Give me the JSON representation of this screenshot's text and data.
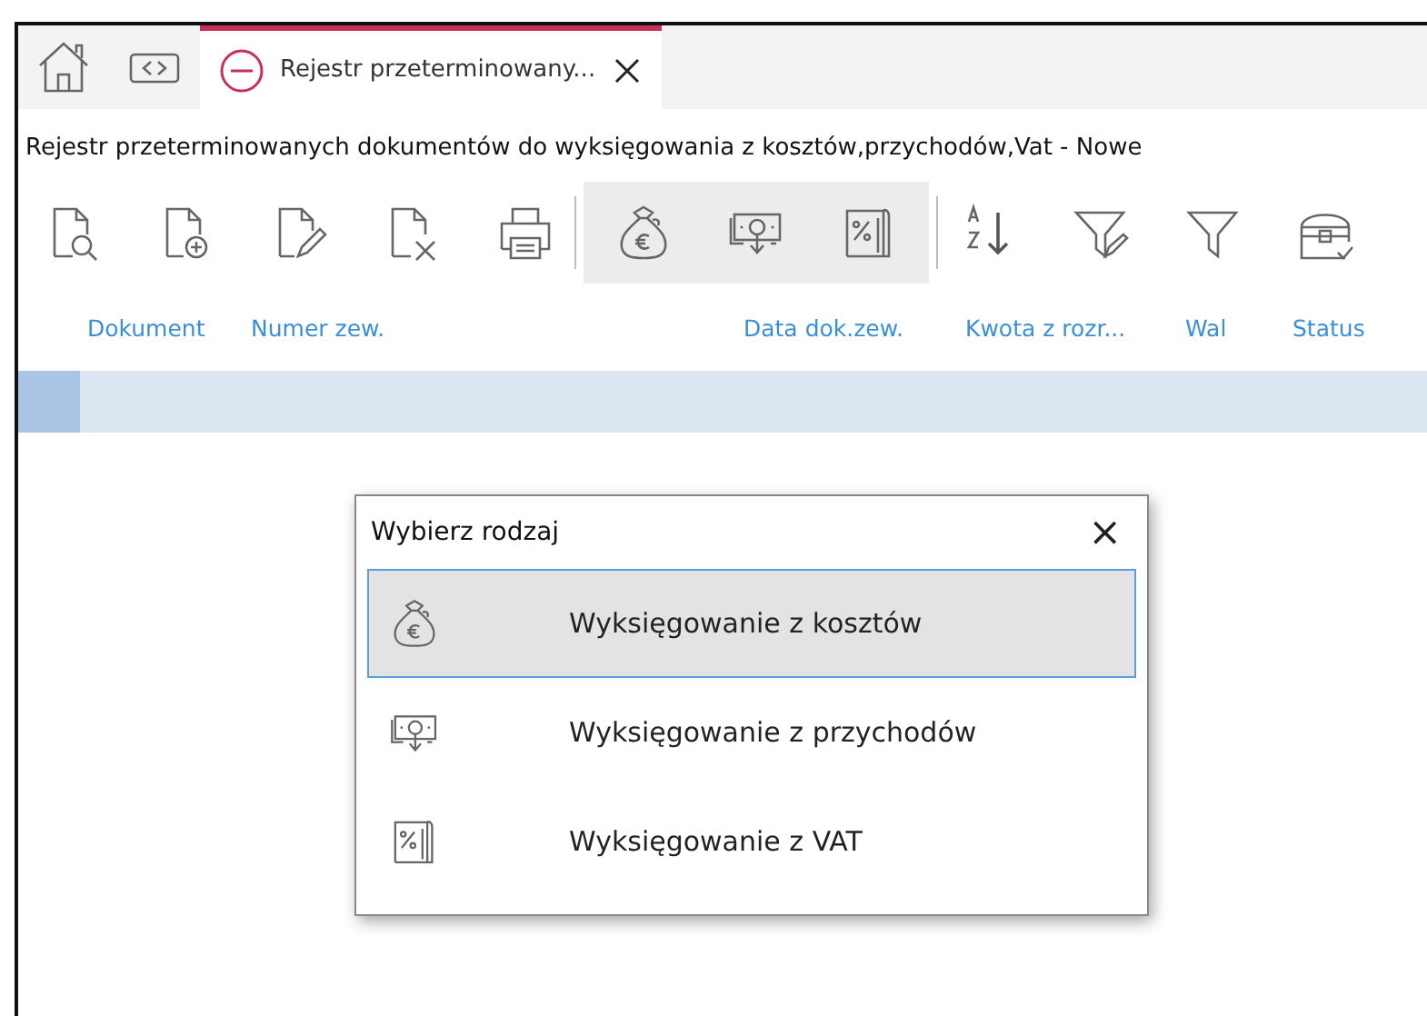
{
  "tabs": [
    {
      "kind": "home",
      "selected": false
    },
    {
      "kind": "nav",
      "selected": false
    },
    {
      "kind": "doc",
      "label": "Rejestr przeterminowany...",
      "selected": true
    }
  ],
  "window": {
    "title": "Rejestr przeterminowanych dokumentów do wyksięgowania z kosztów,przychodów,Vat - Nowe"
  },
  "toolbar": [
    [
      {
        "kind": "doc-search"
      },
      {
        "kind": "doc-add"
      },
      {
        "kind": "doc-edit"
      },
      {
        "kind": "doc-delete"
      },
      {
        "kind": "print"
      }
    ],
    [
      {
        "kind": "money-bag"
      },
      {
        "kind": "banknote"
      },
      {
        "kind": "percent-doc"
      }
    ],
    [
      {
        "kind": "sort"
      },
      {
        "kind": "filter-edit"
      },
      {
        "kind": "filter"
      },
      {
        "kind": "chest"
      }
    ]
  ],
  "table": {
    "columns": [
      "Dokument",
      "Numer zew.",
      "Data dok.zew.",
      "Kwota z rozr...",
      "Wal",
      "Status"
    ]
  },
  "dialog": {
    "title": "Wybierz rodzaj",
    "close": "×",
    "items": [
      {
        "kind": "money-bag",
        "label": "Wyksięgowanie z kosztów",
        "selected": true
      },
      {
        "kind": "banknote",
        "label": "Wyksięgowanie z przychodów",
        "selected": false
      },
      {
        "kind": "percent-doc",
        "label": "Wyksięgowanie z VAT",
        "selected": false
      }
    ]
  }
}
